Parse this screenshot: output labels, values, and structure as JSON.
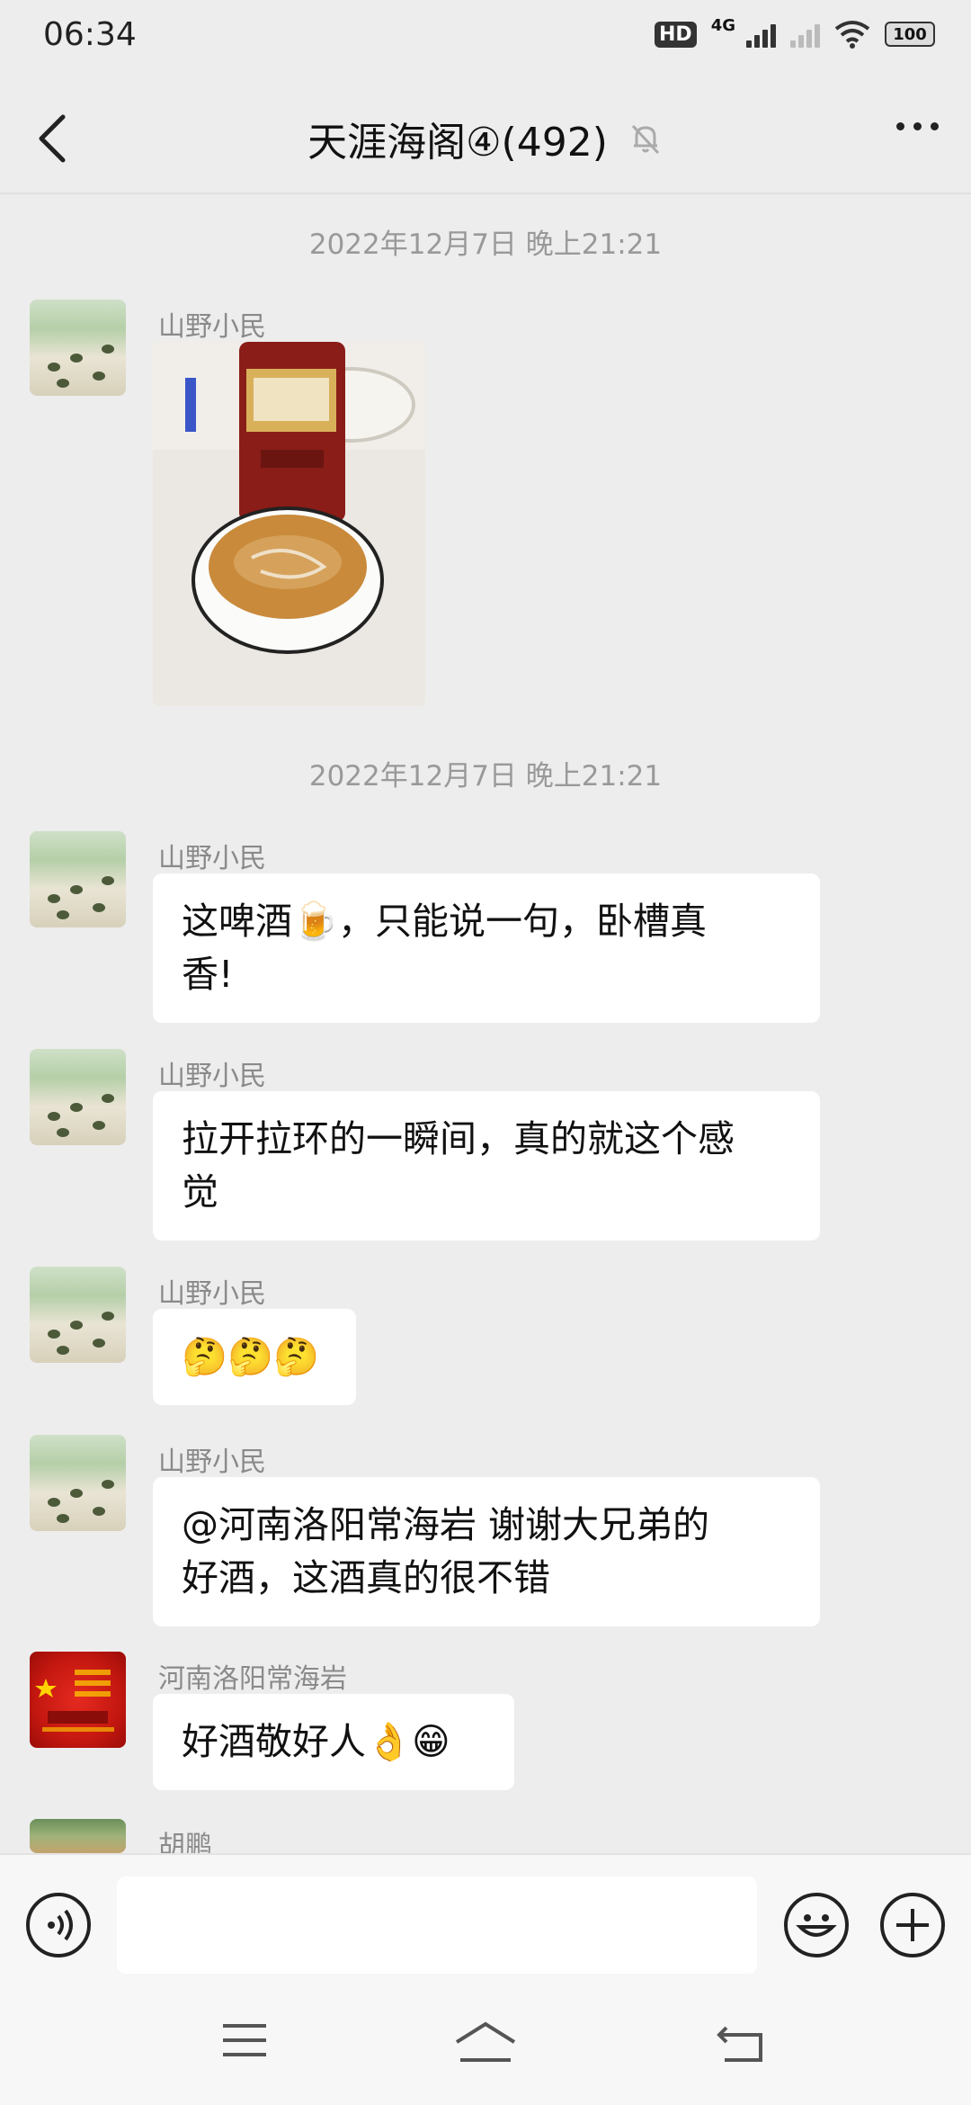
{
  "status": {
    "time": "06:34",
    "hd_label": "HD",
    "network": "4G",
    "battery": "100"
  },
  "header": {
    "title": "天涯海阁④(492)"
  },
  "messages": {
    "ts1": "2022年12月7日 晚上21:21",
    "ts2": "2022年12月7日 晚上21:21",
    "m1": {
      "sender": "山野小民",
      "type": "image"
    },
    "m2": {
      "sender": "山野小民",
      "line1": "这啤酒🍺，只能说一句，卧槽真",
      "line2": "香!"
    },
    "m3": {
      "sender": "山野小民",
      "line1": "拉开拉环的一瞬间，真的就这个感",
      "line2": "觉"
    },
    "m4": {
      "sender": "山野小民",
      "text": "🤔🤔🤔"
    },
    "m5": {
      "sender": "山野小民",
      "line1": "@河南洛阳常海岩 谢谢大兄弟的",
      "line2": "好酒，这酒真的很不错"
    },
    "m6": {
      "sender": "河南洛阳常海岩",
      "text": "好酒敬好人👌😁"
    },
    "m7": {
      "sender": "胡鹏"
    }
  },
  "input": {
    "placeholder": ""
  },
  "icons": {
    "back": "chevron-left-icon",
    "mute": "bell-off-icon",
    "more": "more-icon",
    "voice": "voice-icon",
    "emoji": "emoji-icon",
    "add": "plus-icon",
    "menu": "menu-icon",
    "home": "home-icon",
    "return": "back-nav-icon"
  }
}
